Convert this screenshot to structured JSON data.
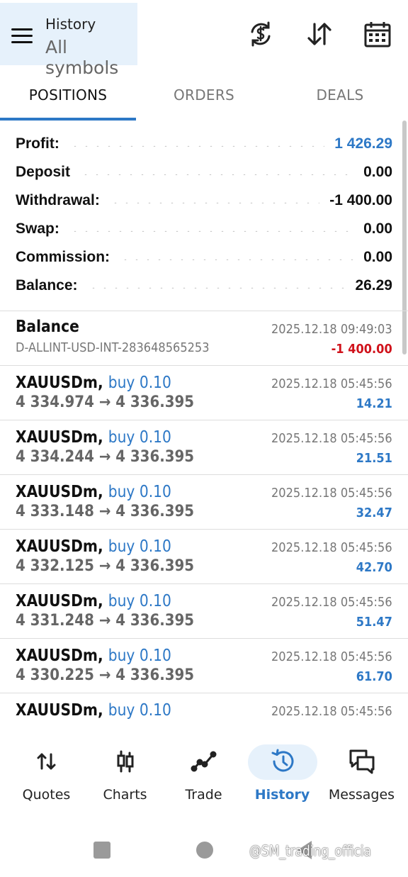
{
  "header": {
    "title": "History",
    "subtitle": "All symbols",
    "icons": [
      "menu-icon",
      "currency-exchange-icon",
      "sort-icon",
      "calendar-icon"
    ]
  },
  "tabs": [
    {
      "label": "POSITIONS",
      "active": true
    },
    {
      "label": "ORDERS",
      "active": false
    },
    {
      "label": "DEALS",
      "active": false
    }
  ],
  "summary": {
    "rows": [
      {
        "label": "Profit:",
        "value": "1 426.29",
        "color": "#2d78c6"
      },
      {
        "label": "Deposit",
        "value": "0.00"
      },
      {
        "label": "Withdrawal:",
        "value": "-1 400.00"
      },
      {
        "label": "Swap:",
        "value": "0.00"
      },
      {
        "label": "Commission:",
        "value": "0.00"
      },
      {
        "label": "Balance:",
        "value": "26.29"
      }
    ]
  },
  "balance_op": {
    "title": "Balance",
    "comment": "D-ALLINT-USD-INT-283648565253",
    "time": "2025.12.18 09:49:03",
    "amount": "-1 400.00",
    "amount_color": "#d0121b"
  },
  "deals": [
    {
      "symbol": "XAUUSDm,",
      "type": "buy 0.10",
      "prices": "4 334.974 → 4 336.395",
      "time": "2025.12.18 05:45:56",
      "profit": "14.21"
    },
    {
      "symbol": "XAUUSDm,",
      "type": "buy 0.10",
      "prices": "4 334.244 → 4 336.395",
      "time": "2025.12.18 05:45:56",
      "profit": "21.51"
    },
    {
      "symbol": "XAUUSDm,",
      "type": "buy 0.10",
      "prices": "4 333.148 → 4 336.395",
      "time": "2025.12.18 05:45:56",
      "profit": "32.47"
    },
    {
      "symbol": "XAUUSDm,",
      "type": "buy 0.10",
      "prices": "4 332.125 → 4 336.395",
      "time": "2025.12.18 05:45:56",
      "profit": "42.70"
    },
    {
      "symbol": "XAUUSDm,",
      "type": "buy 0.10",
      "prices": "4 331.248 → 4 336.395",
      "time": "2025.12.18 05:45:56",
      "profit": "51.47"
    },
    {
      "symbol": "XAUUSDm,",
      "type": "buy 0.10",
      "prices": "4 330.225 → 4 336.395",
      "time": "2025.12.18 05:45:56",
      "profit": "61.70"
    },
    {
      "symbol": "XAUUSDm,",
      "type": "buy 0.10",
      "prices": "",
      "time": "2025.12.18 05:45:56",
      "profit": ""
    }
  ],
  "bottom_nav": [
    {
      "label": "Quotes",
      "icon": "quotes-icon",
      "active": false
    },
    {
      "label": "Charts",
      "icon": "charts-icon",
      "active": false
    },
    {
      "label": "Trade",
      "icon": "trade-icon",
      "active": false
    },
    {
      "label": "History",
      "icon": "history-icon",
      "active": true
    },
    {
      "label": "Messages",
      "icon": "messages-icon",
      "active": false
    }
  ],
  "watermark": "@SM_trading_officia",
  "accent_color": "#2d78c6"
}
